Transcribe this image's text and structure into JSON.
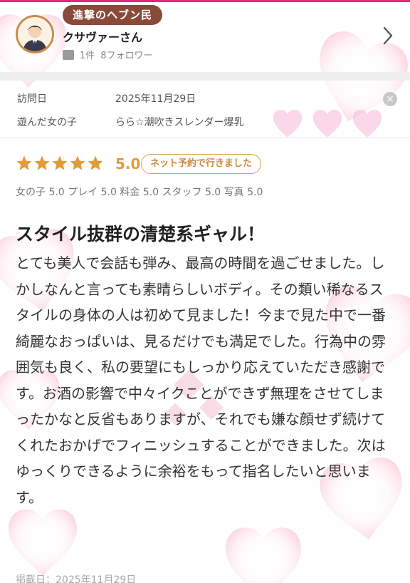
{
  "reviewer": {
    "rank_badge": "進撃のヘブン民",
    "name": "クサヴァーさん",
    "post_count": "1件",
    "followers": "8フォロワー"
  },
  "visit": {
    "date_label": "訪問日",
    "date_value": "2025年11月29日",
    "girl_label": "遊んだ女の子",
    "girl_value": "らら☆潮吹きスレンダー爆乳"
  },
  "rating": {
    "stars": 5,
    "score": "5.0",
    "badge": "ネット予約で行きました",
    "subscores": "女の子 5.0 プレイ 5.0 料金 5.0 スタッフ 5.0 写真 5.0"
  },
  "review": {
    "title": "スタイル抜群の清楚系ギャル！",
    "body": "とても美人で会話も弾み、最高の時間を過ごせました。しかしなんと言っても素晴らしいボディ。その類い稀なるスタイルの身体の人は初めて見ました！今まで見た中で一番綺麗なおっぱいは、見るだけでも満足でした。行為中の雰囲気も良く、私の要望にもしっかり応えていただき感謝です。お酒の影響で中々イクことができず無理をさせてしまったかなと反省もありますが、それでも嫌な顔せず続けてくれたおかげでフィニッシュすることができました。次はゆっくりできるように余裕をもって指名したいと思います。",
    "posted": "掲載日：2025年11月29日"
  },
  "colors": {
    "accent_pink": "#e9257a",
    "badge_brown": "#8a4a3a",
    "star_orange": "#e39a3b",
    "heart_pink": "#f7a8bd"
  },
  "icons": [
    "avatar-icon",
    "stats-icon",
    "chevron-right-icon",
    "close-icon",
    "star-icon"
  ]
}
